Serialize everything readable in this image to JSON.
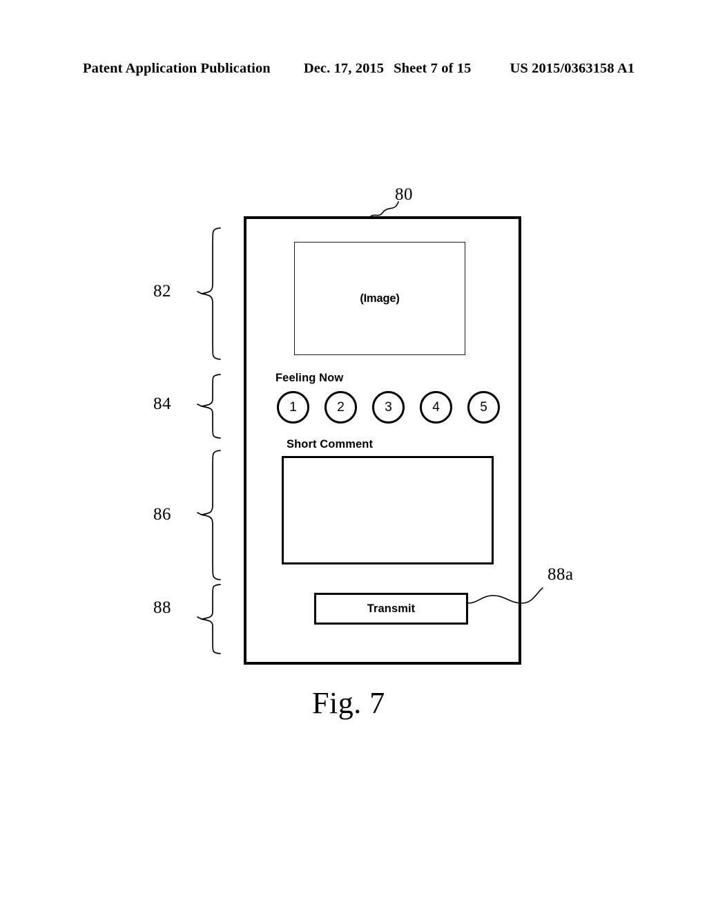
{
  "header": {
    "publication": "Patent Application Publication",
    "date": "Dec. 17, 2015",
    "sheet": "Sheet 7 of 15",
    "patent_number": "US 2015/0363158 A1"
  },
  "figure": {
    "caption": "Fig. 7",
    "device_ref": "80"
  },
  "device": {
    "image_region": {
      "ref": "82",
      "placeholder": "(Image)"
    },
    "feeling_region": {
      "ref": "84",
      "label": "Feeling Now",
      "options": [
        "1",
        "2",
        "3",
        "4",
        "5"
      ]
    },
    "comment_region": {
      "ref": "86",
      "label": "Short Comment",
      "value": ""
    },
    "transmit_region": {
      "ref": "88",
      "button_ref": "88a",
      "button_label": "Transmit"
    }
  },
  "colors": {
    "line": "#000000",
    "background": "#ffffff"
  }
}
